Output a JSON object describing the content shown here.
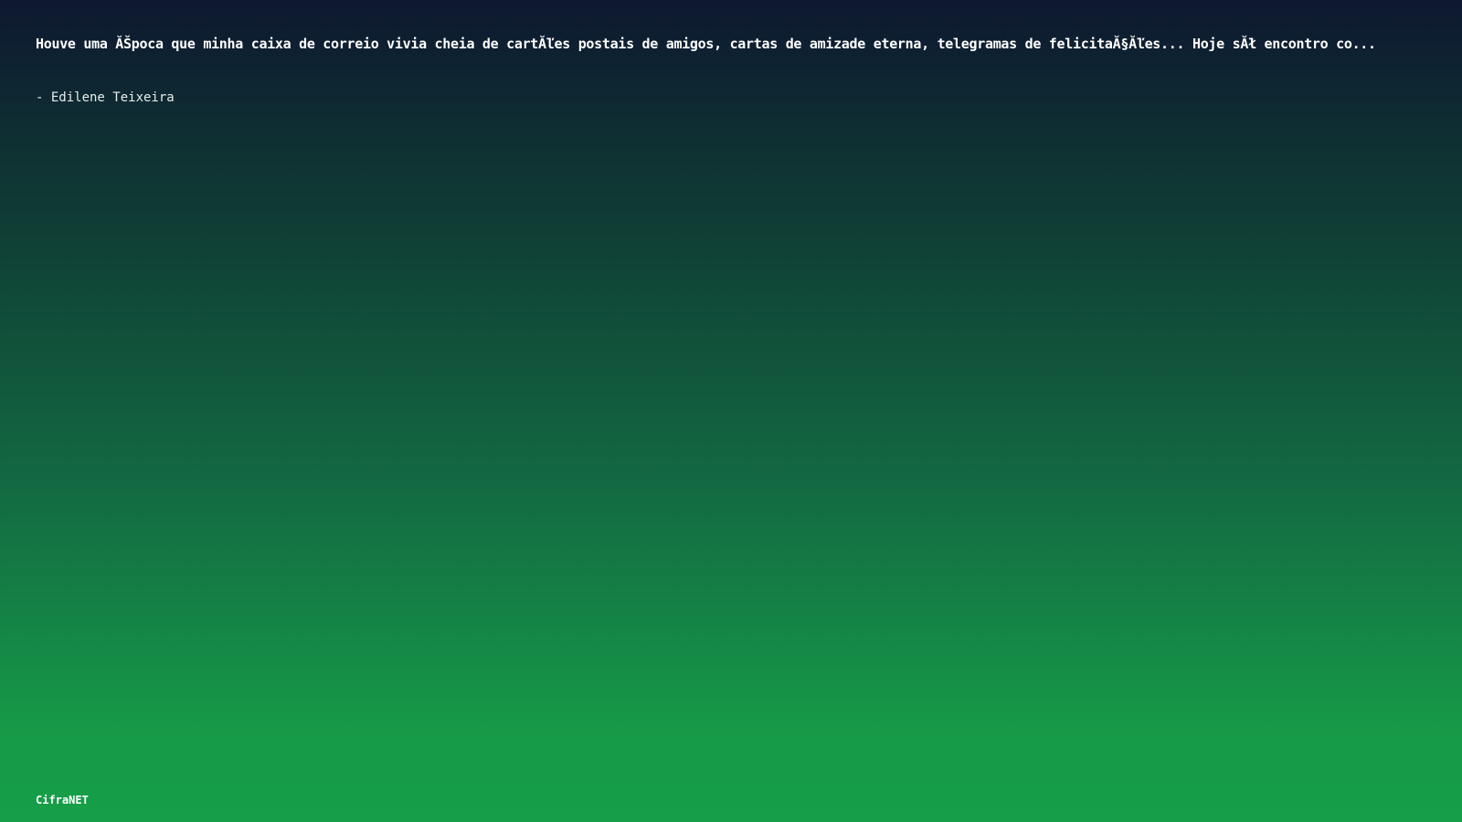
{
  "quote": {
    "text": "Houve uma ĂŠpoca que minha caixa de correio vivia cheia de cartĂľes postais de amigos, cartas de amizade eterna, telegramas de felicitaĂ§Ăľes... Hoje sĂł encontro co...",
    "author": "- Edilene Teixeira"
  },
  "footer": {
    "brand": "CifraNET"
  },
  "colors": {
    "gradient_top": "#0e1830",
    "gradient_bottom": "#169e48",
    "text": "#ffffff"
  }
}
